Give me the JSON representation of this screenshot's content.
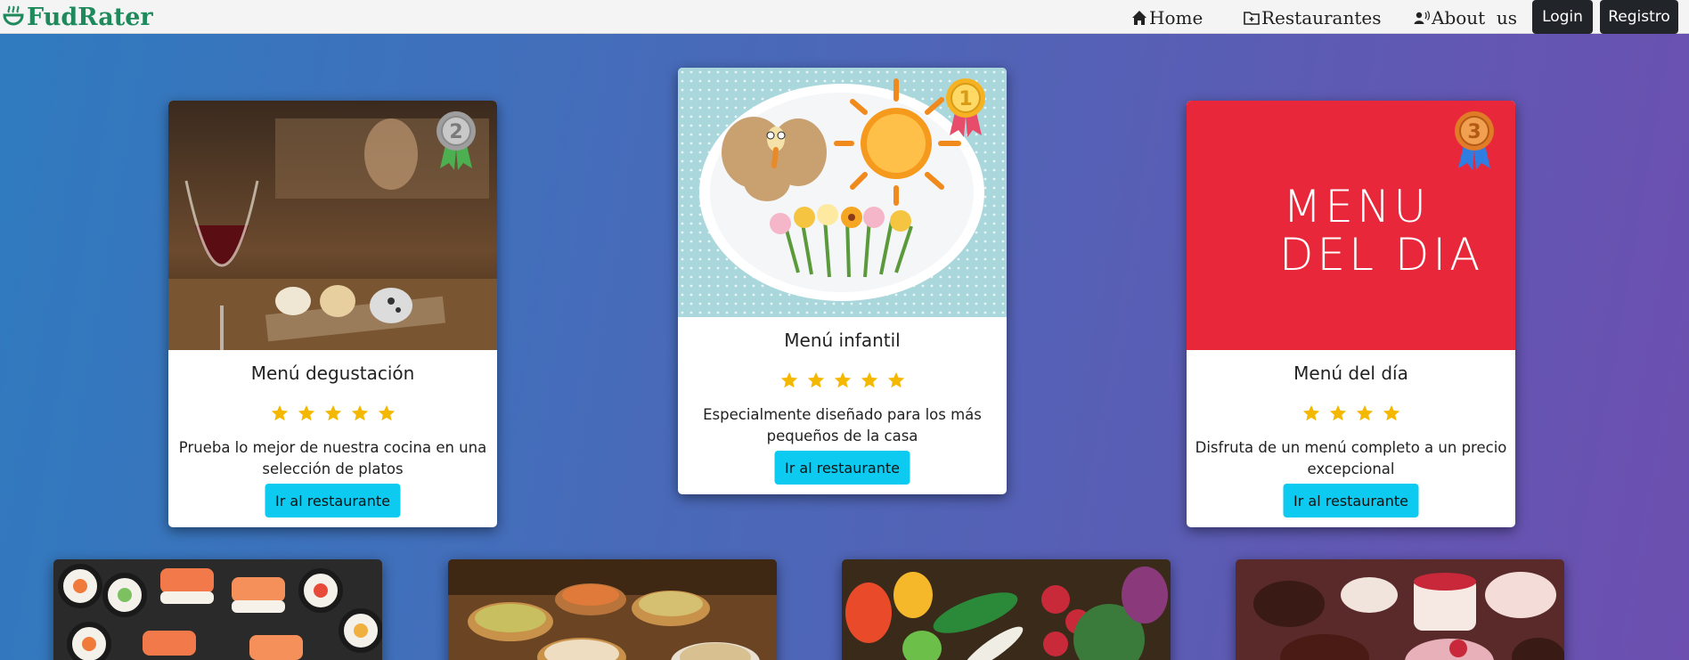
{
  "brand": {
    "name": "FudRater",
    "icon": "food-bowl-icon",
    "color": "#1e8a5c"
  },
  "nav": {
    "home": "Home",
    "restaurantes": "Restaurantes",
    "about": "About  us",
    "login": "Login",
    "registro": "Registro"
  },
  "button_label": "Ir al restaurante",
  "cards": [
    {
      "title": "Menú degustación",
      "rating": 5,
      "rank": "2",
      "description": "Prueba lo mejor de nuestra cocina en una selección de platos",
      "medal_color": "#9e9e9e",
      "ribbon_color": "#4caf50"
    },
    {
      "title": "Menú infantil",
      "rating": 5,
      "rank": "1",
      "description": "Especialmente diseñado para los más pequeños de la casa",
      "medal_color": "#f5b324",
      "ribbon_color": "#e74c6a"
    },
    {
      "title": "Menú del día",
      "rating": 4,
      "rank": "3",
      "description": "Disfruta de un menú completo a un precio excepcional",
      "medal_color": "#e07b28",
      "ribbon_color": "#2f7de1",
      "image_text_line1": "MENU",
      "image_text_line2": "DEL DIA"
    }
  ],
  "bottom_cards": [
    "sushi-image",
    "tapas-image",
    "vegetables-image",
    "desserts-image"
  ],
  "colors": {
    "accent_button": "#0dcaf0",
    "star": "#f5b800",
    "nav_dark": "#212529"
  }
}
